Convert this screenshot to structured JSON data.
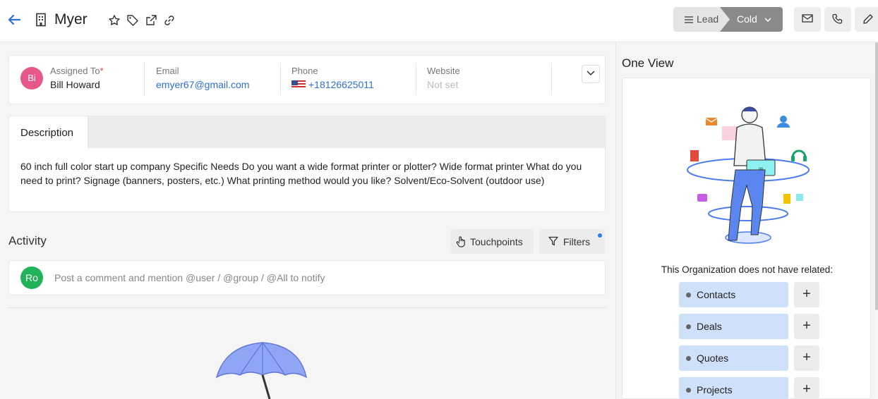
{
  "header": {
    "title": "Myer",
    "status": {
      "stage": "Lead",
      "value": "Cold"
    }
  },
  "info": {
    "avatar_initials": "Bi",
    "assigned_label": "Assigned To",
    "assigned_required": "*",
    "assigned_value": "Bill Howard",
    "email_label": "Email",
    "email_value": "emyer67@gmail.com",
    "phone_label": "Phone",
    "phone_value": "+18126625011",
    "website_label": "Website",
    "website_value": "Not set"
  },
  "description": {
    "tab_label": "Description",
    "text": "60 inch full color start up company Specific Needs Do you want a wide format printer or plotter? Wide format printer What do you need to print? Signage (banners, posters, etc.) What printing method would you like? Solvent/Eco-Solvent (outdoor use)"
  },
  "activity": {
    "title": "Activity",
    "touchpoints_label": "Touchpoints",
    "filters_label": "Filters",
    "comment_initials": "Ro",
    "comment_placeholder": "Post a comment and mention @user / @group / @All to notify"
  },
  "one_view": {
    "title": "One View",
    "no_related_text": "This Organization does not have related:",
    "related": [
      {
        "label": "Contacts",
        "add": "+"
      },
      {
        "label": "Deals",
        "add": "+"
      },
      {
        "label": "Quotes",
        "add": "+"
      },
      {
        "label": "Projects",
        "add": "+"
      }
    ]
  },
  "colors": {
    "accent": "#2f6fd6",
    "avatar_user": "#e8578a",
    "avatar_comment": "#21b35a",
    "related_bg": "#cfe0fb",
    "cold_status": "#8a8a8a"
  }
}
